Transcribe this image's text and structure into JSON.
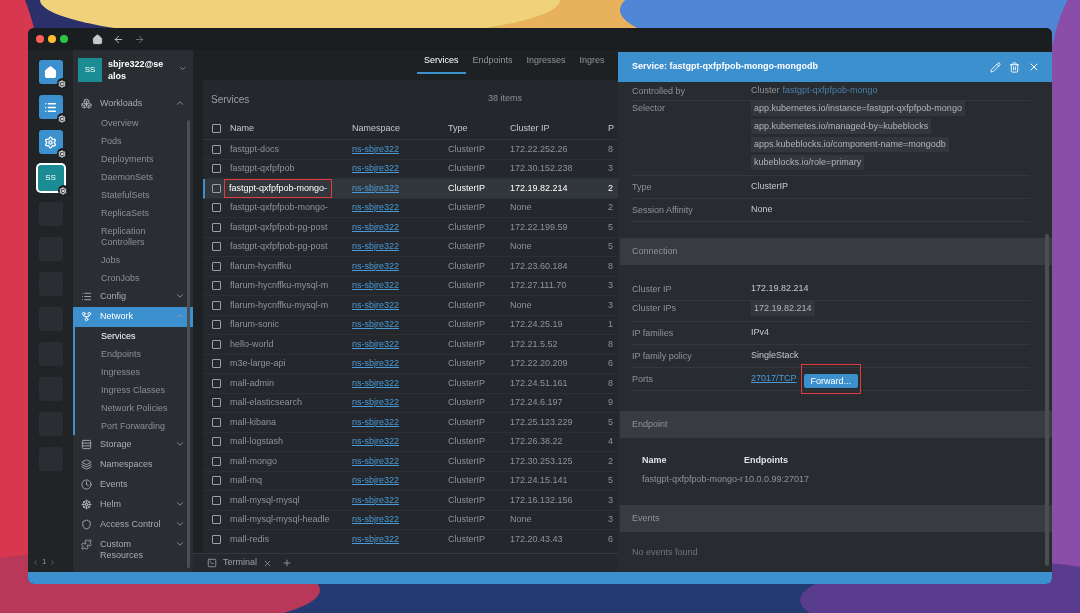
{
  "rail": {
    "items": [
      {
        "kind": "home",
        "selected": false
      },
      {
        "kind": "list",
        "selected": false
      },
      {
        "kind": "settings",
        "selected": false
      },
      {
        "kind": "avatar",
        "label": "SS",
        "selected": true
      },
      {
        "kind": "empty",
        "selected": false
      },
      {
        "kind": "empty",
        "selected": false
      },
      {
        "kind": "empty",
        "selected": false
      },
      {
        "kind": "empty",
        "selected": false
      },
      {
        "kind": "empty",
        "selected": false
      },
      {
        "kind": "empty",
        "selected": false
      },
      {
        "kind": "empty",
        "selected": false
      },
      {
        "kind": "empty",
        "selected": false
      }
    ],
    "page": "1"
  },
  "cluster": {
    "avatar": "SS",
    "name": "sbjre322@sealos"
  },
  "nav": [
    {
      "kind": "group",
      "label": "Workloads",
      "selected": false,
      "expanded": true,
      "children": [
        {
          "label": "Overview",
          "selected": false
        },
        {
          "label": "Pods",
          "selected": false
        },
        {
          "label": "Deployments",
          "selected": false
        },
        {
          "label": "DaemonSets",
          "selected": false
        },
        {
          "label": "StatefulSets",
          "selected": false
        },
        {
          "label": "ReplicaSets",
          "selected": false
        },
        {
          "label": "Replication Controllers",
          "selected": false
        },
        {
          "label": "Jobs",
          "selected": false
        },
        {
          "label": "CronJobs",
          "selected": false
        }
      ]
    },
    {
      "kind": "group",
      "label": "Config",
      "selected": false,
      "expanded": false
    },
    {
      "kind": "group",
      "label": "Network",
      "selected": true,
      "expanded": true,
      "children": [
        {
          "label": "Services",
          "selected": true
        },
        {
          "label": "Endpoints",
          "selected": false
        },
        {
          "label": "Ingresses",
          "selected": false
        },
        {
          "label": "Ingress Classes",
          "selected": false
        },
        {
          "label": "Network Policies",
          "selected": false
        },
        {
          "label": "Port Forwarding",
          "selected": false
        }
      ]
    },
    {
      "kind": "group",
      "label": "Storage",
      "selected": false,
      "expanded": false
    },
    {
      "kind": "link",
      "label": "Namespaces",
      "selected": false
    },
    {
      "kind": "link",
      "label": "Events",
      "selected": false
    },
    {
      "kind": "group",
      "label": "Helm",
      "selected": false,
      "expanded": false
    },
    {
      "kind": "group",
      "label": "Access Control",
      "selected": false,
      "expanded": false
    },
    {
      "kind": "group",
      "label": "Custom Resources",
      "selected": false,
      "expanded": false
    }
  ],
  "tabs": [
    {
      "label": "Services",
      "selected": true
    },
    {
      "label": "Endpoints",
      "selected": false
    },
    {
      "label": "Ingresses",
      "selected": false
    },
    {
      "label": "Ingres",
      "selected": false
    }
  ],
  "list": {
    "title": "Services",
    "count": "38 items",
    "header_checked": false,
    "columns": [
      "Name",
      "Namespace",
      "Type",
      "Cluster IP",
      "P"
    ],
    "rows": [
      {
        "name": "fastgpt-docs",
        "namespace": "ns-sbjre322",
        "type": "ClusterIP",
        "cluster_ip": "172.22.252.26",
        "port": "8",
        "checked": false,
        "selected": false
      },
      {
        "name": "fastgpt-qxfpfpob",
        "namespace": "ns-sbjre322",
        "type": "ClusterIP",
        "cluster_ip": "172.30.152.238",
        "port": "3",
        "checked": false,
        "selected": false
      },
      {
        "name": "fastgpt-qxfpfpob-mongo-",
        "namespace": "ns-sbjre322",
        "type": "ClusterIP",
        "cluster_ip": "172.19.82.214",
        "port": "2",
        "checked": false,
        "selected": true
      },
      {
        "name": "fastgpt-qxfpfpob-mongo-",
        "namespace": "ns-sbjre322",
        "type": "ClusterIP",
        "cluster_ip": "None",
        "port": "2",
        "checked": false,
        "selected": false
      },
      {
        "name": "fastgpt-qxfpfpob-pg-post",
        "namespace": "ns-sbjre322",
        "type": "ClusterIP",
        "cluster_ip": "172.22.199.59",
        "port": "5",
        "checked": false,
        "selected": false
      },
      {
        "name": "fastgpt-qxfpfpob-pg-post",
        "namespace": "ns-sbjre322",
        "type": "ClusterIP",
        "cluster_ip": "None",
        "port": "5",
        "checked": false,
        "selected": false
      },
      {
        "name": "flarum-hycnffku",
        "namespace": "ns-sbjre322",
        "type": "ClusterIP",
        "cluster_ip": "172.23.60.184",
        "port": "8",
        "checked": false,
        "selected": false
      },
      {
        "name": "flarum-hycnffku-mysql-m",
        "namespace": "ns-sbjre322",
        "type": "ClusterIP",
        "cluster_ip": "172.27.111.70",
        "port": "3",
        "checked": false,
        "selected": false
      },
      {
        "name": "flarum-hycnffku-mysql-m",
        "namespace": "ns-sbjre322",
        "type": "ClusterIP",
        "cluster_ip": "None",
        "port": "3",
        "checked": false,
        "selected": false
      },
      {
        "name": "flarum-sonic",
        "namespace": "ns-sbjre322",
        "type": "ClusterIP",
        "cluster_ip": "172.24.25.19",
        "port": "1",
        "checked": false,
        "selected": false
      },
      {
        "name": "hello-world",
        "namespace": "ns-sbjre322",
        "type": "ClusterIP",
        "cluster_ip": "172.21.5.52",
        "port": "8",
        "checked": false,
        "selected": false
      },
      {
        "name": "m3e-large-api",
        "namespace": "ns-sbjre322",
        "type": "ClusterIP",
        "cluster_ip": "172.22.20.209",
        "port": "6",
        "checked": false,
        "selected": false
      },
      {
        "name": "mall-admin",
        "namespace": "ns-sbjre322",
        "type": "ClusterIP",
        "cluster_ip": "172.24.51.161",
        "port": "8",
        "checked": false,
        "selected": false
      },
      {
        "name": "mall-elasticsearch",
        "namespace": "ns-sbjre322",
        "type": "ClusterIP",
        "cluster_ip": "172.24.6.197",
        "port": "9",
        "checked": false,
        "selected": false
      },
      {
        "name": "mall-kibana",
        "namespace": "ns-sbjre322",
        "type": "ClusterIP",
        "cluster_ip": "172.25.123.229",
        "port": "5",
        "checked": false,
        "selected": false
      },
      {
        "name": "mall-logstash",
        "namespace": "ns-sbjre322",
        "type": "ClusterIP",
        "cluster_ip": "172.26.38.22",
        "port": "4",
        "checked": false,
        "selected": false
      },
      {
        "name": "mall-mongo",
        "namespace": "ns-sbjre322",
        "type": "ClusterIP",
        "cluster_ip": "172.30.253.125",
        "port": "2",
        "checked": false,
        "selected": false
      },
      {
        "name": "mall-mq",
        "namespace": "ns-sbjre322",
        "type": "ClusterIP",
        "cluster_ip": "172.24.15.141",
        "port": "5",
        "checked": false,
        "selected": false
      },
      {
        "name": "mall-mysql-mysql",
        "namespace": "ns-sbjre322",
        "type": "ClusterIP",
        "cluster_ip": "172.16.132.156",
        "port": "3",
        "checked": false,
        "selected": false
      },
      {
        "name": "mall-mysql-mysql-headle",
        "namespace": "ns-sbjre322",
        "type": "ClusterIP",
        "cluster_ip": "None",
        "port": "3",
        "checked": false,
        "selected": false
      },
      {
        "name": "mall-redis",
        "namespace": "ns-sbjre322",
        "type": "ClusterIP",
        "cluster_ip": "172.20.43.43",
        "port": "6",
        "checked": false,
        "selected": false
      }
    ]
  },
  "dock": {
    "tab": "Terminal"
  },
  "details": {
    "title": "Service: fastgpt-qxfpfpob-mongo-mongodb",
    "properties": [
      {
        "kind": "link",
        "label": "Controlled by",
        "value": "Cluster",
        "link": "fastgpt-qxfpfpob-mongo"
      },
      {
        "kind": "chips",
        "label": "Selector",
        "chips": [
          "app.kubernetes.io/instance=fastgpt-qxfpfpob-mongo",
          "app.kubernetes.io/managed-by=kubeblocks",
          "apps.kubeblocks.io/component-name=mongodb",
          "kubeblocks.io/role=primary"
        ]
      },
      {
        "kind": "text",
        "label": "Type",
        "value": "ClusterIP"
      },
      {
        "kind": "text",
        "label": "Session Affinity",
        "value": "None"
      }
    ],
    "sections": [
      {
        "kind": "properties",
        "title": "Connection",
        "properties": [
          {
            "kind": "text",
            "label": "Cluster IP",
            "value": "172.19.82.214"
          },
          {
            "kind": "chips",
            "label": "Cluster IPs",
            "chips": [
              "172.19.82.214"
            ]
          },
          {
            "kind": "text",
            "label": "IP families",
            "value": "IPv4"
          },
          {
            "kind": "text",
            "label": "IP family policy",
            "value": "SingleStack"
          },
          {
            "kind": "ports",
            "label": "Ports",
            "link": "27017/TCP",
            "button": "Forward..."
          }
        ]
      },
      {
        "kind": "table",
        "title": "Endpoint",
        "columns": [
          "Name",
          "Endpoints"
        ],
        "rows": [
          [
            "fastgpt-qxfpfpob-mongo-r",
            "10.0.0.99:27017"
          ]
        ]
      },
      {
        "kind": "empty",
        "title": "Events",
        "text": "No events found"
      }
    ]
  }
}
